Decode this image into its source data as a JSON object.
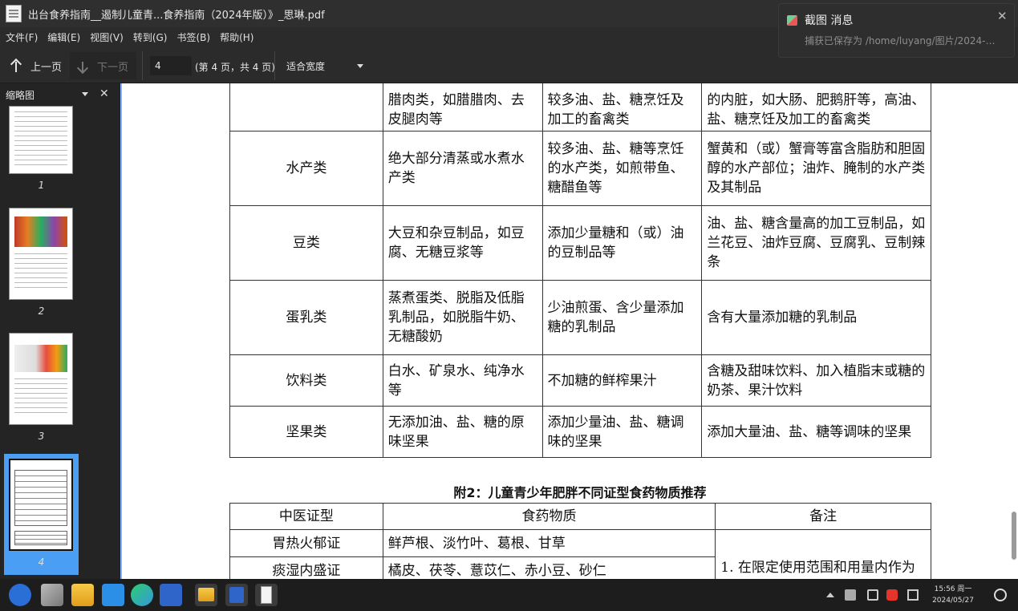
{
  "window": {
    "title": "出台食养指南__遏制儿童青...食养指南（2024年版）》_思琳.pdf"
  },
  "menu": [
    "文件(F)",
    "编辑(E)",
    "视图(V)",
    "转到(G)",
    "书签(B)",
    "帮助(H)"
  ],
  "toolbar": {
    "prev_label": "上一页",
    "next_label": "下一页",
    "page_value": "4",
    "page_count": "(第 4 页，共 4 页)",
    "zoom": "适合宽度"
  },
  "sidebar": {
    "title": "缩略图",
    "thumbnails": [
      "1",
      "2",
      "3",
      "4"
    ]
  },
  "table1": [
    {
      "cat": "",
      "c1": "腊肉类，如腊腊肉、去皮腿肉等",
      "c2": "较多油、盐、糖烹饪及加工的畜禽类",
      "c3": "的内脏，如大肠、肥鹅肝等，高油、盐、糖烹饪及加工的畜禽类"
    },
    {
      "cat": "水产类",
      "c1": "绝大部分清蒸或水煮水产类",
      "c2": "较多油、盐、糖等烹饪的水产类，如煎带鱼、糖醋鱼等",
      "c3": "蟹黄和（或）蟹膏等富含脂肪和胆固醇的水产部位；油炸、腌制的水产类及其制品"
    },
    {
      "cat": "豆类",
      "c1": "大豆和杂豆制品，如豆腐、无糖豆浆等",
      "c2": "添加少量糖和（或）油的豆制品等",
      "c3": "油、盐、糖含量高的加工豆制品，如兰花豆、油炸豆腐、豆腐乳、豆制辣条"
    },
    {
      "cat": "蛋乳类",
      "c1": "蒸煮蛋类、脱脂及低脂乳制品，如脱脂牛奶、无糖酸奶",
      "c2": "少油煎蛋、含少量添加糖的乳制品",
      "c3": "含有大量添加糖的乳制品"
    },
    {
      "cat": "饮料类",
      "c1": "白水、矿泉水、纯净水等",
      "c2": "不加糖的鲜榨果汁",
      "c3": "含糖及甜味饮料、加入植脂末或糖的奶茶、果汁饮料"
    },
    {
      "cat": "坚果类",
      "c1": "无添加油、盐、糖的原味坚果",
      "c2": "添加少量油、盐、糖调味的坚果",
      "c3": "添加大量油、盐、糖等调味的坚果"
    }
  ],
  "heading2": "附2：儿童青少年肥胖不同证型食药物质推荐",
  "table2": {
    "headers": [
      "中医证型",
      "食药物质",
      "备注"
    ],
    "rows": [
      {
        "type": "胃热火郁证",
        "items": "鲜芦根、淡竹叶、葛根、甘草"
      },
      {
        "type": "痰湿内盛证",
        "items": "橘皮、茯苓、薏苡仁、赤小豆、砂仁"
      }
    ],
    "note": "1. 在限定使用范围和用量内作为"
  },
  "notification": {
    "title": "截图 消息",
    "body": "捕获已保存为 /home/luyang/图片/2024-…"
  },
  "clock": {
    "time": "15:56 周一",
    "date": "2024/05/27"
  }
}
